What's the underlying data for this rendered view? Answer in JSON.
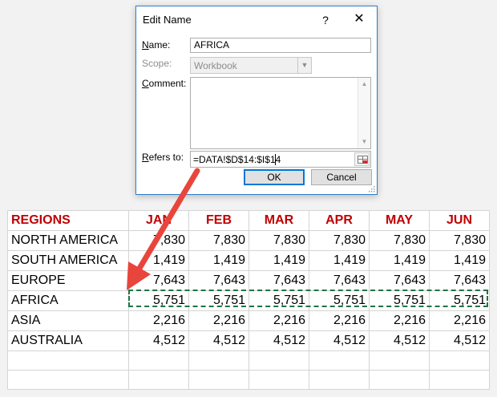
{
  "dialog": {
    "title": "Edit Name",
    "help": "?",
    "close": "✕",
    "name_label_accel": "N",
    "name_label_rest": "ame:",
    "name_value": "AFRICA",
    "scope_label": "Scope:",
    "scope_value": "Workbook",
    "comment_label_accel": "C",
    "comment_label_rest": "omment:",
    "comment_value": "",
    "refers_label_accel": "R",
    "refers_label_rest": "efers to:",
    "refers_value": "=DATA!$D$14:$I$14",
    "ok_label": "OK",
    "cancel_label": "Cancel"
  },
  "sheet": {
    "header": [
      "REGIONS",
      "JAN",
      "FEB",
      "MAR",
      "APR",
      "MAY",
      "JUN"
    ],
    "rows": [
      {
        "region": "NORTH AMERICA",
        "values": [
          "7,830",
          "7,830",
          "7,830",
          "7,830",
          "7,830",
          "7,830"
        ]
      },
      {
        "region": "SOUTH AMERICA",
        "values": [
          "1,419",
          "1,419",
          "1,419",
          "1,419",
          "1,419",
          "1,419"
        ]
      },
      {
        "region": "EUROPE",
        "values": [
          "7,643",
          "7,643",
          "7,643",
          "7,643",
          "7,643",
          "7,643"
        ]
      },
      {
        "region": "AFRICA",
        "values": [
          "5,751",
          "5,751",
          "5,751",
          "5,751",
          "5,751",
          "5,751"
        ]
      },
      {
        "region": "ASIA",
        "values": [
          "2,216",
          "2,216",
          "2,216",
          "2,216",
          "2,216",
          "2,216"
        ]
      },
      {
        "region": "AUSTRALIA",
        "values": [
          "4,512",
          "4,512",
          "4,512",
          "4,512",
          "4,512",
          "4,512"
        ]
      }
    ]
  },
  "colors": {
    "header_text": "#c00000",
    "selection_border": "#217346",
    "arrow": "#e8453c",
    "dialog_border": "#2f7fc8"
  },
  "icons": [
    "help-icon",
    "close-icon",
    "dropdown-arrow-icon",
    "collapse-dialog-icon",
    "scroll-up-icon",
    "scroll-down-icon",
    "resize-grip-icon"
  ]
}
